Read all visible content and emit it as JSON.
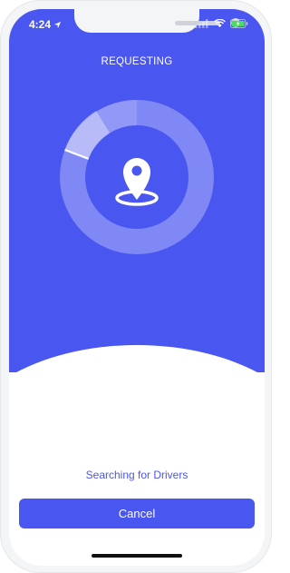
{
  "status_bar": {
    "time": "4:24",
    "icons": [
      "location-arrow-icon",
      "signal-icon",
      "wifi-icon",
      "battery-charging-icon"
    ]
  },
  "header": {
    "title": "REQUESTING"
  },
  "radar": {
    "icon": "map-pin-icon",
    "colors": {
      "background": "#4a56f0",
      "ring": "#7f88f4",
      "inner": "#4a56f0",
      "sweep": "#ffffff"
    }
  },
  "footer": {
    "status_text": "Searching for Drivers",
    "cancel_label": "Cancel"
  },
  "theme": {
    "accent": "#4a56f0"
  }
}
